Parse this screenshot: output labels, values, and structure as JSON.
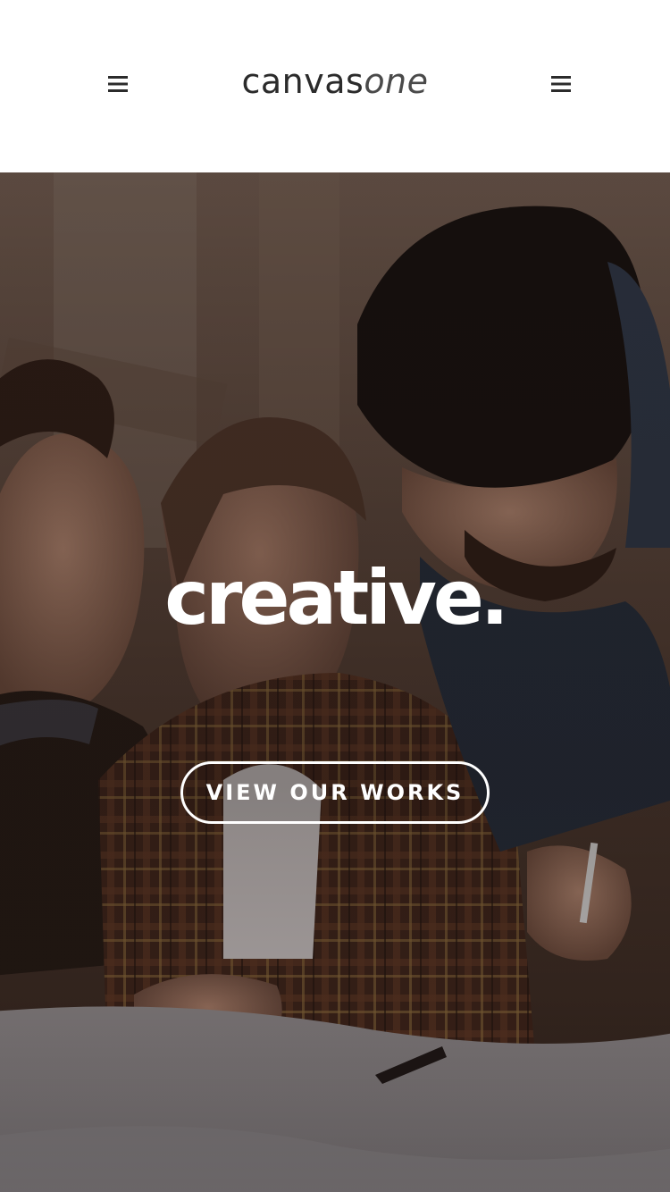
{
  "header": {
    "logo_primary": "canvas",
    "logo_secondary": "one",
    "left_icon": "menu-icon",
    "right_icon": "menu-icon"
  },
  "hero": {
    "headline": "creative.",
    "cta_label": "VIEW OUR WORKS"
  },
  "colors": {
    "header_bg": "#ffffff",
    "logo_text": "#2b2b2b",
    "hero_text": "#ffffff"
  }
}
